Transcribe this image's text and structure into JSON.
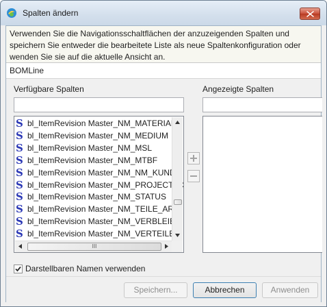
{
  "window": {
    "title": "Spalten ändern",
    "icon": "teamcenter-app-icon",
    "close_icon": "close-icon"
  },
  "description": "Verwenden Sie die Navigationsschaltflächen der anzuzeigenden Spalten und speichern Sie entweder die bearbeitete Liste als neue Spaltenkonfiguration oder wenden Sie sie auf die aktuelle Ansicht an.",
  "object_type": "BOMLine",
  "available": {
    "label": "Verfügbare Spalten",
    "filter_value": "",
    "items": [
      "bl_ItemRevision Master_NM_MATERIAL",
      "bl_ItemRevision Master_NM_MEDIUM",
      "bl_ItemRevision Master_NM_MSL",
      "bl_ItemRevision Master_NM_MTBF",
      "bl_ItemRevision Master_NM_NM_KUNDE",
      "bl_ItemRevision Master_NM_PROJECT_C",
      "bl_ItemRevision Master_NM_STATUS",
      "bl_ItemRevision Master_NM_TEILE_ART",
      "bl_ItemRevision Master_NM_VERBLEIB",
      "bl_ItemRevision Master_NM_VERTEILER"
    ],
    "item_icon": "S",
    "hscroll_grip": "III"
  },
  "displayed": {
    "label": "Angezeigte Spalten",
    "filter_value": "",
    "items": []
  },
  "move_buttons": {
    "add_icon": "plus-icon",
    "remove_icon": "minus-icon"
  },
  "checkbox": {
    "label": "Darstellbaren Namen verwenden",
    "checked": true
  },
  "buttons": {
    "save": "Speichern...",
    "cancel": "Abbrechen",
    "apply": "Anwenden"
  }
}
